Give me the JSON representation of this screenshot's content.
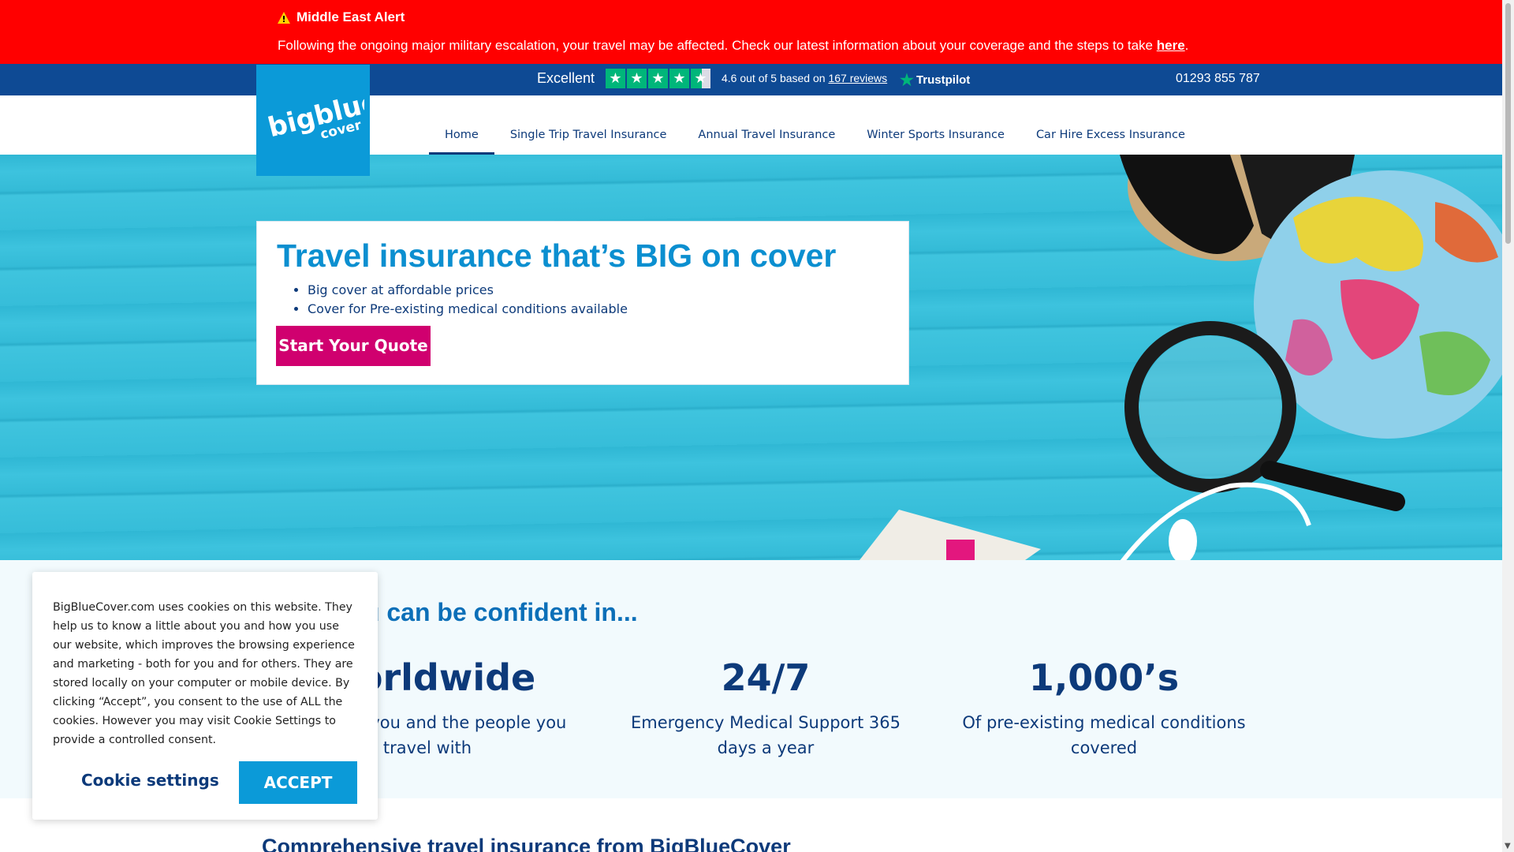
{
  "alert": {
    "title": "Middle East Alert",
    "text": "Following the ongoing major military escalation, your travel may be affected. Check our latest information about your coverage and the steps to take",
    "link": "here",
    "end": "."
  },
  "trustbar": {
    "excellent": "Excellent",
    "rating_text": "4.6 out of 5 based on",
    "reviews_link": "167 reviews",
    "trustpilot": "Trustpilot",
    "phone": "01293 855 787",
    "stars": 4.6
  },
  "logo": {
    "line1": "bigblue",
    "line2": "cover"
  },
  "nav": [
    {
      "label": "Home"
    },
    {
      "label": "Single Trip Travel Insurance"
    },
    {
      "label": "Annual Travel Insurance"
    },
    {
      "label": "Winter Sports Insurance"
    },
    {
      "label": "Car Hire Excess Insurance"
    }
  ],
  "hero": {
    "title": "Travel insurance that’s BIG on cover",
    "bullets": [
      "Big cover at affordable prices",
      "Cover for Pre-existing medical conditions available"
    ],
    "cta": "Start Your Quote"
  },
  "confidence": {
    "heading": "Cover you can be confident in...",
    "stats": [
      {
        "big": "Worldwide",
        "small": "Cover for you and the people you travel with"
      },
      {
        "big": "24/7",
        "small": "Emergency Medical Support 365 days a year"
      },
      {
        "big": "1,000’s",
        "small": "Of pre-existing medical conditions covered"
      }
    ]
  },
  "comp_heading": "Comprehensive travel insurance from BigBlueCover",
  "cookie": {
    "text": "BigBlueCover.com uses cookies on this website. They help us to know a little about you and how you use our website, which improves the browsing experience and marketing - both for you and for others. They are stored locally on your computer or mobile device. By clicking “Accept”, you consent to the use of ALL the cookies. However you may visit Cookie Settings to provide a controlled consent.",
    "settings": "Cookie settings",
    "accept": "ACCEPT"
  },
  "colors": {
    "alert": "#ff0000",
    "navy": "#0e4a94",
    "brand_blue": "#0b9ad8",
    "cta_pink": "#d0006f",
    "trustpilot_green": "#00b67a"
  }
}
